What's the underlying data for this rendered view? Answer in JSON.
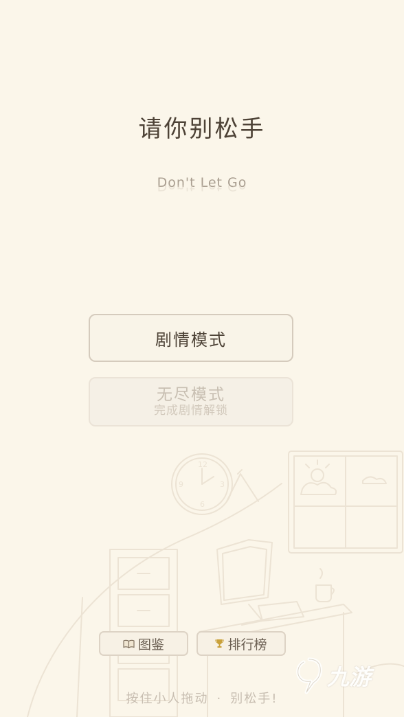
{
  "game": {
    "title": "请你别松手",
    "subtitle": "Don't Let Go"
  },
  "menu": {
    "story_mode_label": "剧情模式",
    "endless_mode_label": "无尽模式",
    "endless_mode_locked_hint": "完成剧情解锁"
  },
  "bottom": {
    "gallery_label": "图鉴",
    "gallery_icon": "book-icon",
    "leaderboard_label": "排行榜",
    "leaderboard_icon": "trophy-icon",
    "hint_left": "按住小人拖动",
    "hint_separator": "·",
    "hint_right": "别松手!"
  },
  "background": {
    "clock_numbers": [
      "12",
      "3",
      "6",
      "9"
    ]
  },
  "watermark": {
    "text": "九游"
  },
  "colors": {
    "background": "#fbf6ea",
    "title": "#4d4236",
    "disabled_text": "#c8bfb2",
    "trophy": "#c9a13b"
  }
}
